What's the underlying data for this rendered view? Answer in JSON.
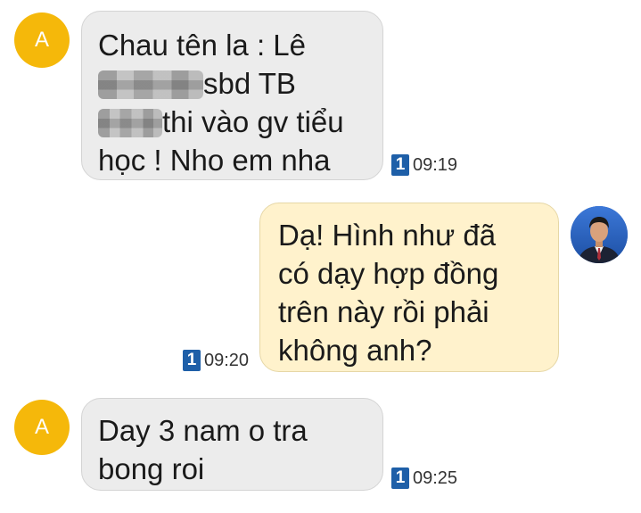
{
  "messages": [
    {
      "sender": "A",
      "direction": "incoming",
      "lines": [
        {
          "text": "Chau tên la : Lê"
        },
        {
          "pre": "",
          "post": "sbd TB"
        },
        {
          "pre": "",
          "post": "thi vào gv tiểu"
        },
        {
          "text": "học ! Nho em nha"
        }
      ],
      "sim": "1",
      "time": "09:19"
    },
    {
      "direction": "outgoing",
      "lines": [
        "Dạ! Hình như đã",
        "có dạy hợp đồng",
        "trên này rồi phải",
        "không anh?"
      ],
      "sim": "1",
      "time": "09:20"
    },
    {
      "sender": "A",
      "direction": "incoming",
      "lines": [
        "Day 3 nam o tra",
        "bong roi"
      ],
      "sim": "1",
      "time": "09:25"
    }
  ],
  "colors": {
    "avatar": "#f5b80a",
    "incoming_bubble": "#ececec",
    "outgoing_bubble": "#fff2cc",
    "sim_badge": "#1e5fa8"
  }
}
